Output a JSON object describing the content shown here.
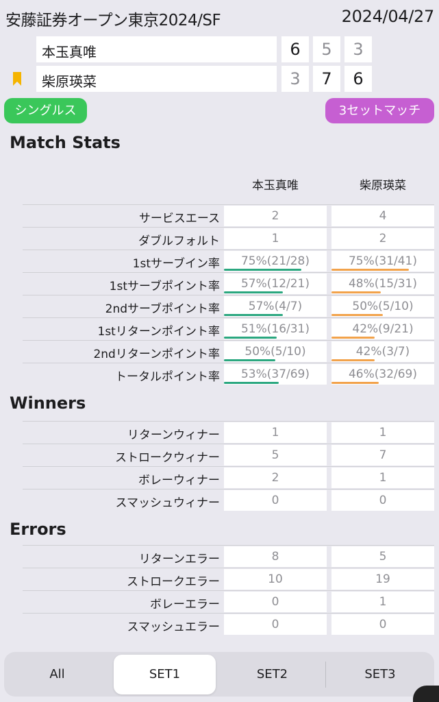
{
  "header": {
    "title": "安藤証券オープン東京2024/SF",
    "date": "2024/04/27"
  },
  "players": [
    {
      "name": "本玉真唯",
      "sets": [
        "6",
        "5",
        "3"
      ],
      "set_won": [
        true,
        false,
        false
      ],
      "serving": false
    },
    {
      "name": "柴原瑛菜",
      "sets": [
        "3",
        "7",
        "6"
      ],
      "set_won": [
        false,
        true,
        true
      ],
      "serving": true
    }
  ],
  "tags": {
    "category": "シングルス",
    "format": "3セットマッチ"
  },
  "colors": {
    "singles_green": "#3ac75a",
    "format_purple": "#c65fd2",
    "player1_bar": "#2aa77f",
    "player2_bar": "#f2a24a",
    "server_marker": "#f5b400"
  },
  "match_stats": {
    "title": "Match Stats",
    "col_p1": "本玉真唯",
    "col_p2": "柴原瑛菜",
    "rows": [
      {
        "label": "サービスエース",
        "p1": "2",
        "p2": "4"
      },
      {
        "label": "ダブルフォルト",
        "p1": "1",
        "p2": "2"
      },
      {
        "label": "1stサーブイン率",
        "p1": "75%(21/28)",
        "p2": "75%(31/41)",
        "p1_pct": 75,
        "p2_pct": 75
      },
      {
        "label": "1stサーブポイント率",
        "p1": "57%(12/21)",
        "p2": "48%(15/31)",
        "p1_pct": 57,
        "p2_pct": 48
      },
      {
        "label": "2ndサーブポイント率",
        "p1": "57%(4/7)",
        "p2": "50%(5/10)",
        "p1_pct": 57,
        "p2_pct": 50
      },
      {
        "label": "1stリターンポイント率",
        "p1": "51%(16/31)",
        "p2": "42%(9/21)",
        "p1_pct": 51,
        "p2_pct": 42
      },
      {
        "label": "2ndリターンポイント率",
        "p1": "50%(5/10)",
        "p2": "42%(3/7)",
        "p1_pct": 50,
        "p2_pct": 42
      },
      {
        "label": "トータルポイント率",
        "p1": "53%(37/69)",
        "p2": "46%(32/69)",
        "p1_pct": 53,
        "p2_pct": 46
      }
    ]
  },
  "winners": {
    "title": "Winners",
    "rows": [
      {
        "label": "リターンウィナー",
        "p1": "1",
        "p2": "1"
      },
      {
        "label": "ストロークウィナー",
        "p1": "5",
        "p2": "7"
      },
      {
        "label": "ボレーウィナー",
        "p1": "2",
        "p2": "1"
      },
      {
        "label": "スマッシュウィナー",
        "p1": "0",
        "p2": "0"
      }
    ]
  },
  "errors": {
    "title": "Errors",
    "rows": [
      {
        "label": "リターンエラー",
        "p1": "8",
        "p2": "5"
      },
      {
        "label": "ストロークエラー",
        "p1": "10",
        "p2": "19"
      },
      {
        "label": "ボレーエラー",
        "p1": "0",
        "p2": "1"
      },
      {
        "label": "スマッシュエラー",
        "p1": "0",
        "p2": "0"
      }
    ]
  },
  "tabs": {
    "items": [
      "All",
      "SET1",
      "SET2",
      "SET3"
    ],
    "active": "SET1"
  }
}
